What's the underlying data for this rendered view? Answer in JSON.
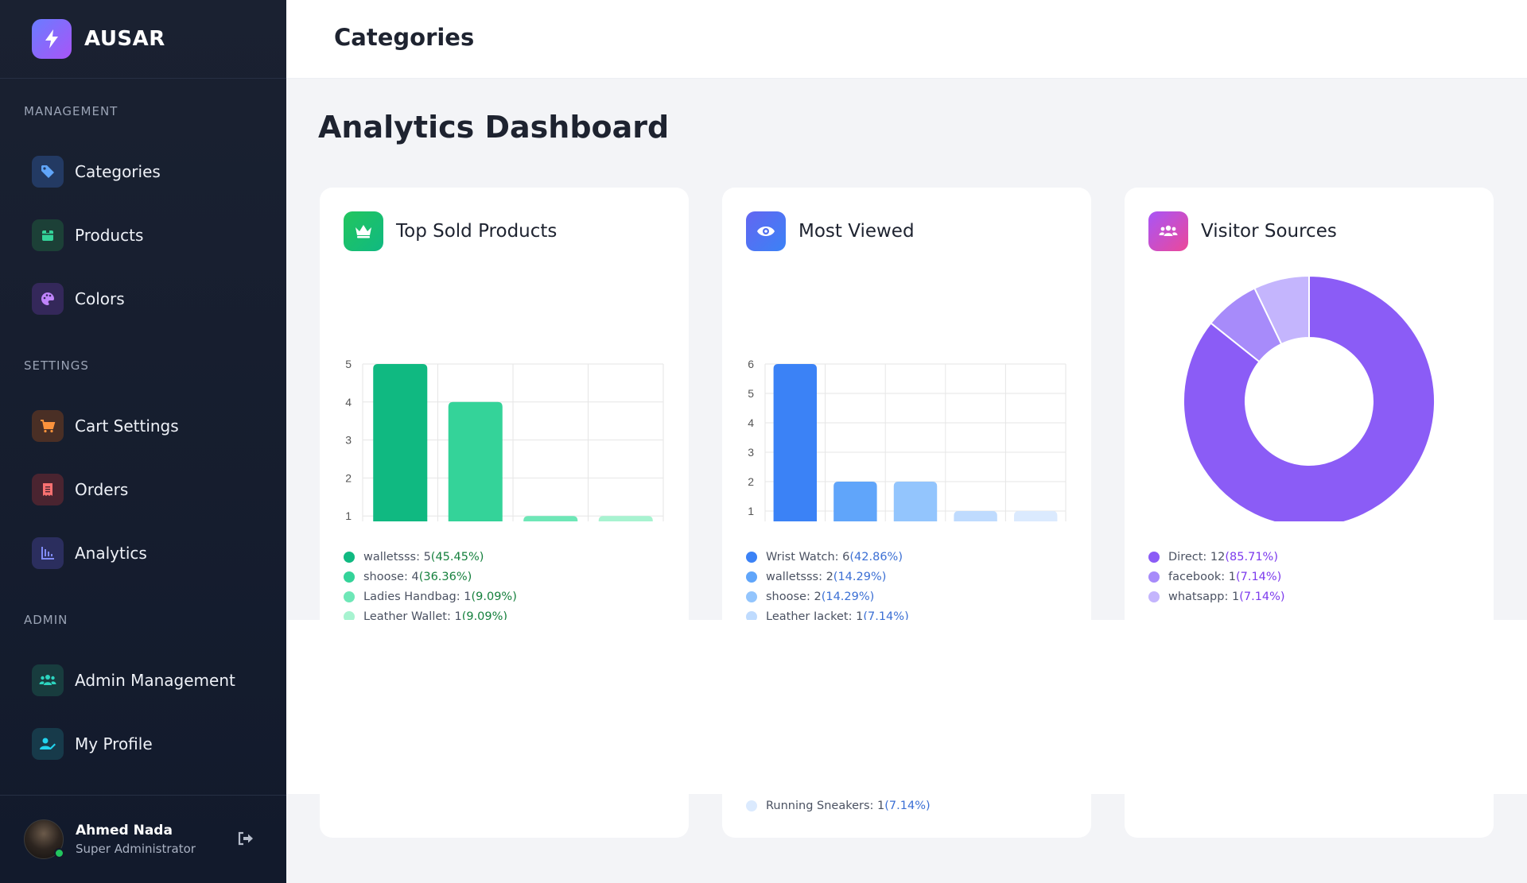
{
  "brand": {
    "name": "AUSAR"
  },
  "sidebar": {
    "sections": {
      "management": "MANAGEMENT",
      "settings": "SETTINGS",
      "admin": "ADMIN"
    },
    "items": [
      {
        "label": "Categories",
        "icon": "tag-icon"
      },
      {
        "label": "Products",
        "icon": "box-icon"
      },
      {
        "label": "Colors",
        "icon": "palette-icon"
      },
      {
        "label": "Cart Settings",
        "icon": "cart-icon"
      },
      {
        "label": "Orders",
        "icon": "receipt-icon"
      },
      {
        "label": "Analytics",
        "icon": "chart-icon"
      },
      {
        "label": "Admin Management",
        "icon": "users-icon"
      },
      {
        "label": "My Profile",
        "icon": "user-edit-icon"
      }
    ],
    "user": {
      "name": "Ahmed Nada",
      "role": "Super Administrator"
    }
  },
  "header": {
    "title": "Categories"
  },
  "page": {
    "title": "Analytics Dashboard"
  },
  "colors": {
    "green": [
      "#10b981",
      "#34d399",
      "#6ee7b7",
      "#a7f3d0"
    ],
    "blue": [
      "#3b82f6",
      "#60a5fa",
      "#93c5fd",
      "#bfdbfe",
      "#dbeafe"
    ],
    "purple": [
      "#8b5cf6",
      "#a78bfa",
      "#c4b5fd"
    ]
  },
  "cards": {
    "top_sold": {
      "title": "Top Sold Products"
    },
    "most_viewed": {
      "title": "Most Viewed"
    },
    "visitor_sources": {
      "title": "Visitor Sources"
    }
  },
  "chart_data": [
    {
      "type": "bar",
      "id": "top_sold",
      "categories": [
        "walletsss",
        "shoose",
        "Ladies Handbag",
        "Leather Wallet"
      ],
      "values": [
        5,
        4,
        1,
        1
      ],
      "ylim": [
        0,
        5
      ],
      "legend": [
        {
          "label": "walletsss: 5",
          "pct": "(45.45%)"
        },
        {
          "label": "shoose: 4",
          "pct": "(36.36%)"
        },
        {
          "label": "Ladies Handbag: 1",
          "pct": "(9.09%)"
        },
        {
          "label": "Leather Wallet: 1",
          "pct": "(9.09%)"
        }
      ]
    },
    {
      "type": "bar",
      "id": "most_viewed",
      "categories": [
        "Wrist Watch",
        "walletsss",
        "shoose",
        "Leather Jacket",
        "Running Sneakers"
      ],
      "values": [
        6,
        2,
        2,
        1,
        1
      ],
      "ylim": [
        0,
        6
      ],
      "legend": [
        {
          "label": "Wrist Watch: 6",
          "pct": "(42.86%)"
        },
        {
          "label": "walletsss: 2",
          "pct": "(14.29%)"
        },
        {
          "label": "shoose: 2",
          "pct": "(14.29%)"
        },
        {
          "label": "Leather Jacket: 1",
          "pct": "(7.14%)"
        },
        {
          "label": "Running Sneakers: 1",
          "pct": "(7.14%)"
        }
      ]
    },
    {
      "type": "pie",
      "id": "visitor_sources",
      "categories": [
        "Direct",
        "facebook",
        "whatsapp"
      ],
      "values": [
        12,
        1,
        1
      ],
      "legend": [
        {
          "label": "Direct: 12",
          "pct": "(85.71%)"
        },
        {
          "label": "facebook: 1",
          "pct": "(7.14%)"
        },
        {
          "label": "whatsapp: 1",
          "pct": "(7.14%)"
        }
      ]
    }
  ]
}
